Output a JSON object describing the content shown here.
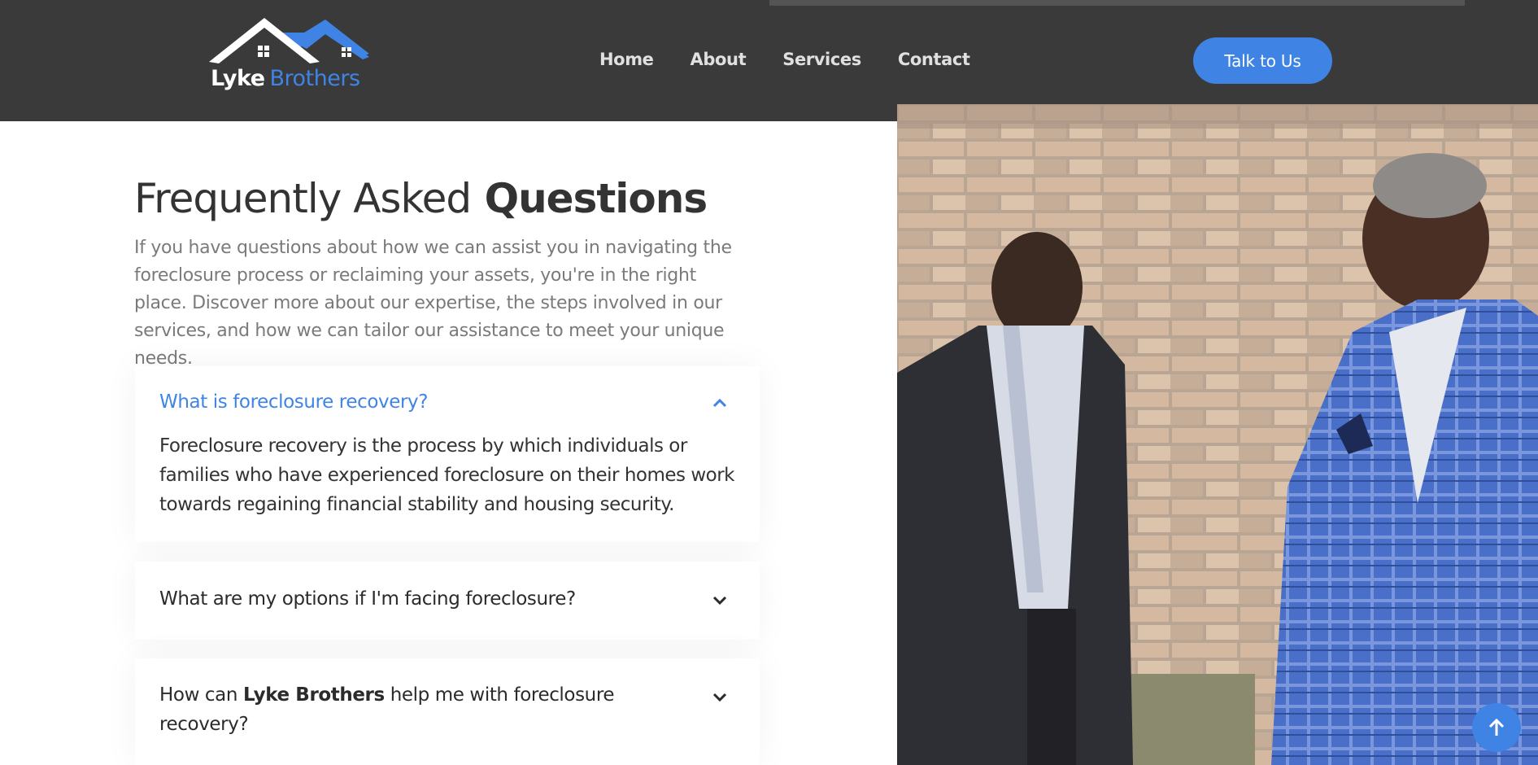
{
  "brand": {
    "name_part1": "Lyke",
    "name_part2": "Brothers",
    "accent_color": "#3f84e5",
    "header_color": "#3a3a3a"
  },
  "nav": {
    "items": [
      {
        "label": "Home"
      },
      {
        "label": "About"
      },
      {
        "label": "Services"
      },
      {
        "label": "Contact"
      }
    ],
    "cta_label": "Talk to Us"
  },
  "faq": {
    "title_light": "Frequently Asked",
    "title_bold": "Questions",
    "intro": "If you have questions about how we can assist you in navigating the foreclosure process or reclaiming your assets, you're in the right place. Discover more about our expertise, the steps involved in our services, and how we can tailor our assistance to meet your unique needs.",
    "items": [
      {
        "question": "What is foreclosure recovery?",
        "answer": "Foreclosure recovery is the process by which individuals or families who have experienced foreclosure on their homes work towards regaining financial stability and housing security.",
        "expanded": true,
        "icon": "chevron-up-icon"
      },
      {
        "question": "What are my options if I'm facing foreclosure?",
        "expanded": false,
        "icon": "chevron-down-icon"
      },
      {
        "question_pre": "How can",
        "question_bold": "Lyke Brothers",
        "question_post": "help me with foreclosure recovery?",
        "expanded": false,
        "icon": "chevron-down-icon"
      }
    ]
  },
  "scroll_top_icon": "arrow-up-icon"
}
